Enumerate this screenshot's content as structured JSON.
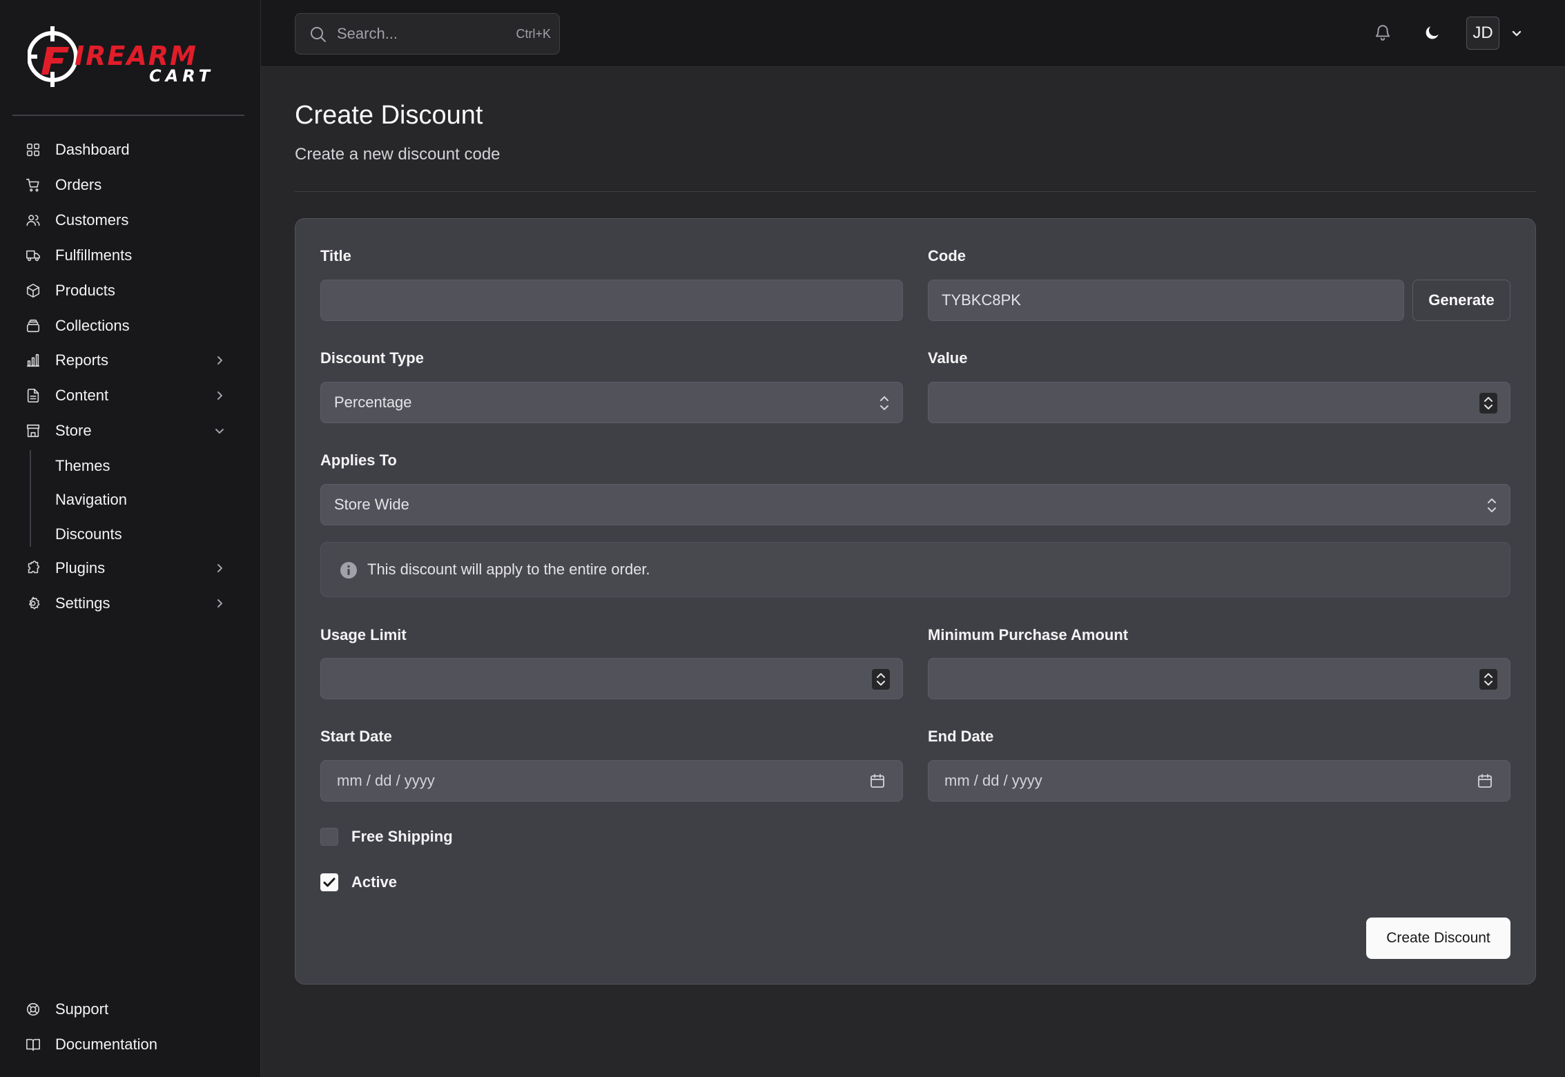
{
  "app": {
    "logo_text_main": "FIREARM",
    "logo_text_sub": "CART",
    "brand_color": "#e11d2a"
  },
  "sidebar": {
    "items": [
      {
        "label": "Dashboard",
        "icon": "dashboard-icon"
      },
      {
        "label": "Orders",
        "icon": "cart-icon"
      },
      {
        "label": "Customers",
        "icon": "users-icon"
      },
      {
        "label": "Fulfillments",
        "icon": "truck-icon"
      },
      {
        "label": "Products",
        "icon": "box-icon"
      },
      {
        "label": "Collections",
        "icon": "layers-icon"
      },
      {
        "label": "Reports",
        "icon": "bar-chart-icon",
        "expandable": true
      },
      {
        "label": "Content",
        "icon": "file-icon",
        "expandable": true
      },
      {
        "label": "Store",
        "icon": "store-icon",
        "expanded": true
      },
      {
        "label": "Plugins",
        "icon": "puzzle-icon",
        "expandable": true
      },
      {
        "label": "Settings",
        "icon": "gear-icon",
        "expandable": true
      }
    ],
    "store_subitems": [
      "Themes",
      "Navigation",
      "Discounts"
    ],
    "footer": [
      {
        "label": "Support",
        "icon": "lifebuoy-icon"
      },
      {
        "label": "Documentation",
        "icon": "book-icon"
      }
    ]
  },
  "header": {
    "search_placeholder": "Search...",
    "search_shortcut": "Ctrl+K",
    "avatar_initials": "JD"
  },
  "page": {
    "title": "Create Discount",
    "subtitle": "Create a new discount code"
  },
  "form": {
    "title_label": "Title",
    "title_value": "",
    "code_label": "Code",
    "code_value": "TYBKC8PK",
    "generate_label": "Generate",
    "discount_type_label": "Discount Type",
    "discount_type_value": "Percentage",
    "value_label": "Value",
    "value_value": "",
    "applies_to_label": "Applies To",
    "applies_to_value": "Store Wide",
    "info_text": "This discount will apply to the entire order.",
    "usage_limit_label": "Usage Limit",
    "min_purchase_label": "Minimum Purchase Amount",
    "start_date_label": "Start Date",
    "start_date_placeholder": "mm / dd / yyyy",
    "end_date_label": "End Date",
    "end_date_placeholder": "mm / dd / yyyy",
    "free_shipping_label": "Free Shipping",
    "free_shipping_checked": false,
    "active_label": "Active",
    "active_checked": true,
    "submit_label": "Create Discount"
  }
}
